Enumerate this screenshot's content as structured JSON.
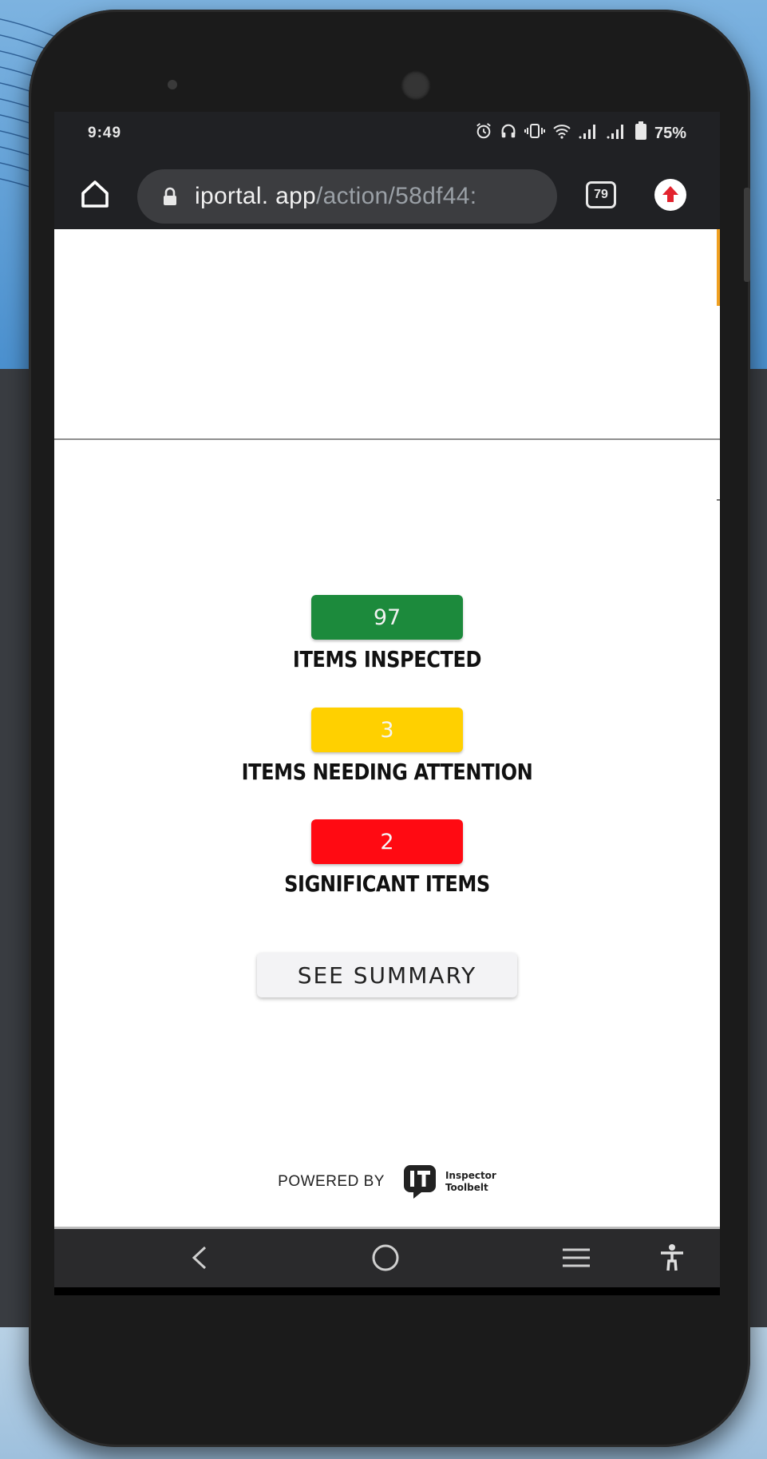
{
  "status_bar": {
    "time": "9:49",
    "battery_percent": "75%",
    "icons": [
      "alarm-icon",
      "headphones-icon",
      "vibrate-icon",
      "wifi-icon",
      "signal-icon",
      "signal-icon",
      "battery-icon"
    ]
  },
  "browser": {
    "url_domain": "iportal. app",
    "url_path": "/action/58df44:",
    "tab_count": "79"
  },
  "stats": [
    {
      "value": "97",
      "label": "ITEMS INSPECTED",
      "color": "#1c8a3c"
    },
    {
      "value": "3",
      "label": "ITEMS NEEDING ATTENTION",
      "color": "#ffd000"
    },
    {
      "value": "2",
      "label": "SIGNIFICANT ITEMS",
      "color": "#ff0a12"
    }
  ],
  "summary_button_label": "SEE SUMMARY",
  "footer": {
    "powered_by": "POWERED BY",
    "logo_lines": [
      "Inspector",
      "Toolbelt"
    ]
  },
  "colors": {
    "accent_orange": "#f0a020",
    "browser_chrome": "#202124"
  }
}
